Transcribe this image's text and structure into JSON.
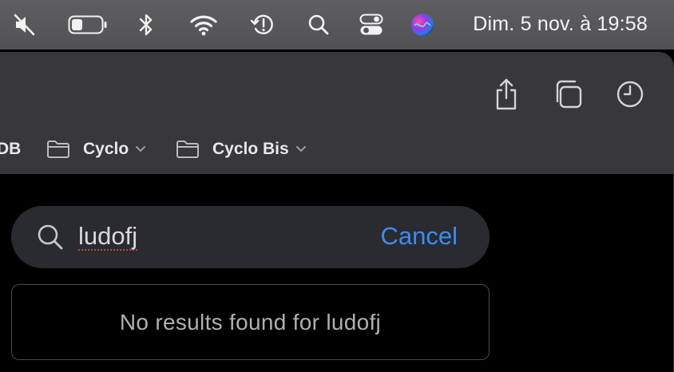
{
  "menubar": {
    "icons": [
      "mute-icon",
      "battery-icon",
      "bluetooth-icon",
      "wifi-icon",
      "time-machine-icon",
      "spotlight-search-icon",
      "control-center-icon",
      "siri-icon"
    ],
    "clock": "Dim. 5 nov. à 19:58"
  },
  "toolbar": {
    "buttons": [
      "share-icon",
      "tabs-overview-icon",
      "history-icon"
    ]
  },
  "favorites": {
    "truncated_label": "DB",
    "items": [
      {
        "label": "Cyclo"
      },
      {
        "label": "Cyclo Bis"
      }
    ]
  },
  "search": {
    "query": "ludofj",
    "cancel_label": "Cancel"
  },
  "results": {
    "message": "No results found for ludofj"
  }
}
